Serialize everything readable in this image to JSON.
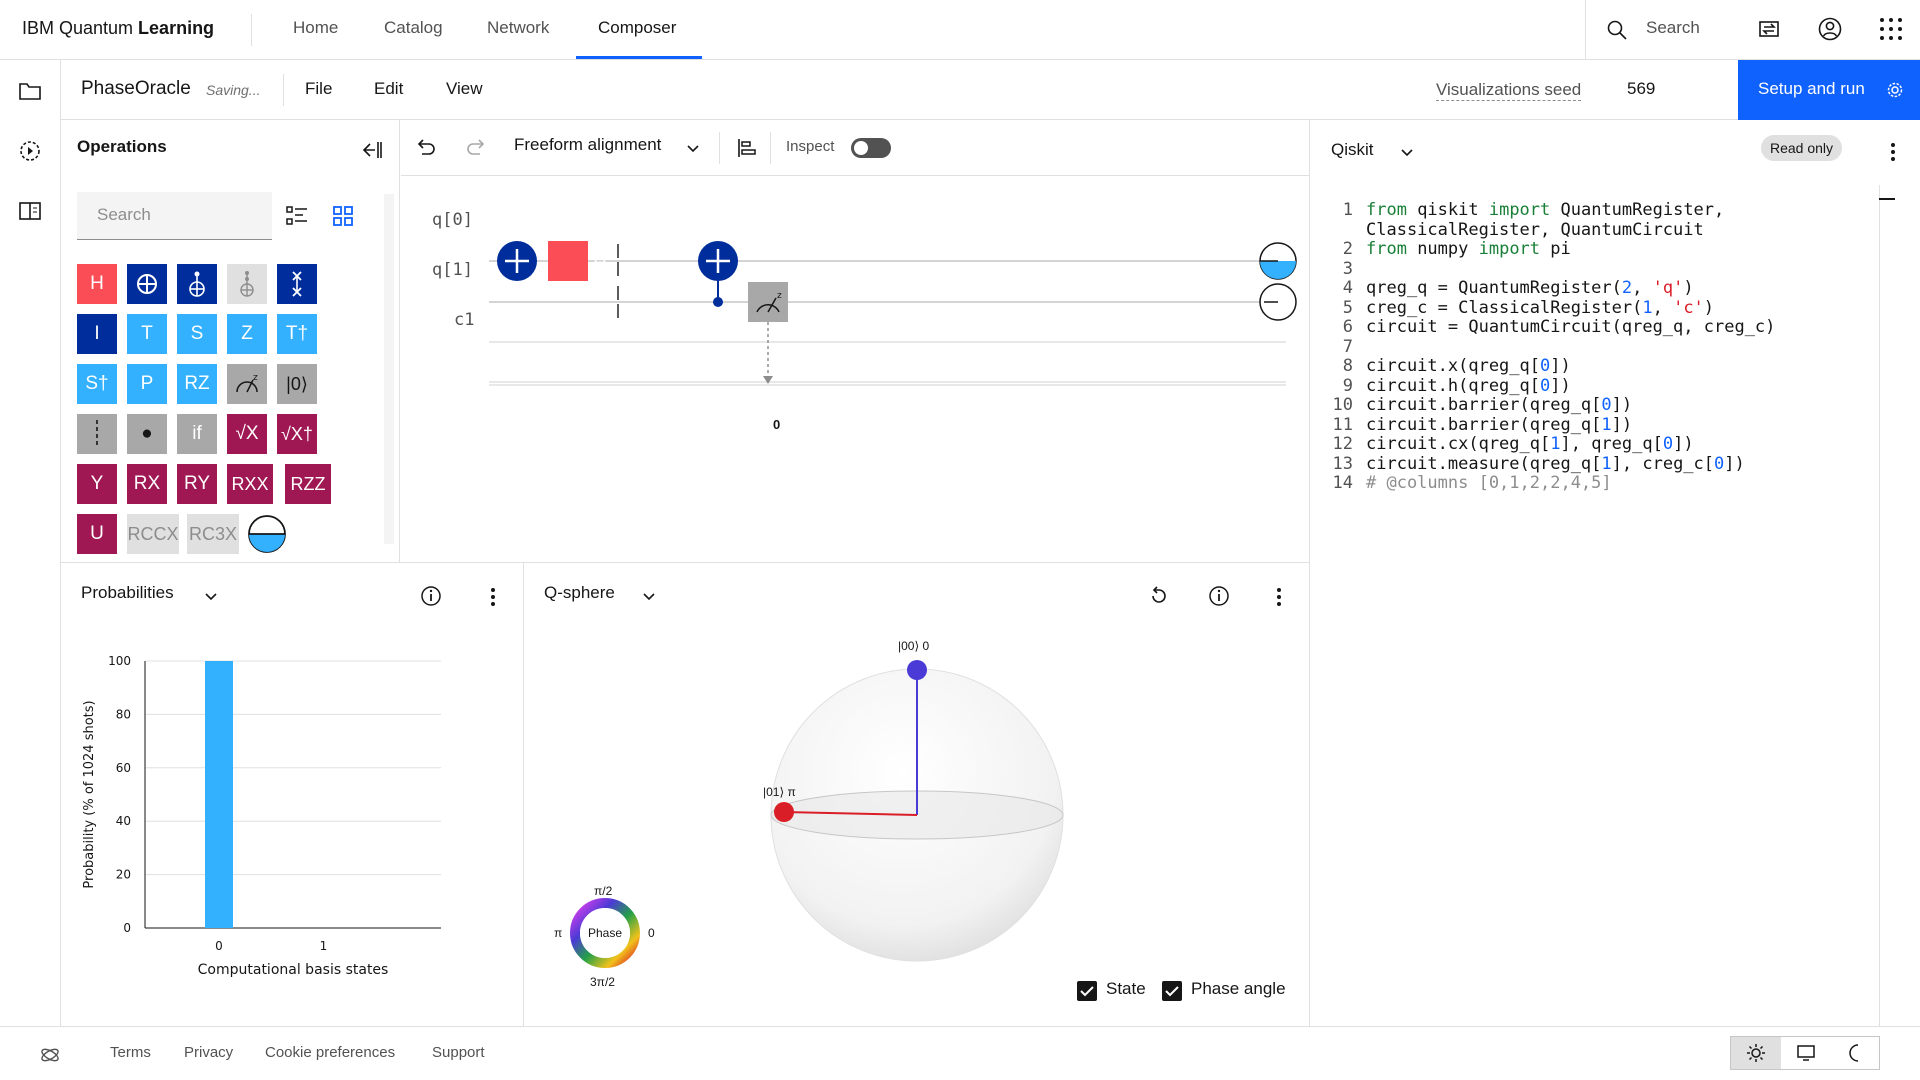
{
  "header": {
    "brand_prefix": "IBM Quantum ",
    "brand_bold": "Learning",
    "nav": [
      "Home",
      "Catalog",
      "Network",
      "Composer"
    ],
    "active_nav": "Composer",
    "search_label": "Search"
  },
  "toolbar": {
    "file_name": "PhaseOracle",
    "status": "Saving...",
    "menus": [
      "File",
      "Edit",
      "View"
    ],
    "seed_label": "Visualizations seed",
    "seed_value": "569",
    "run_label": "Setup and run"
  },
  "operations": {
    "title": "Operations",
    "search_placeholder": "Search",
    "gates": [
      {
        "label": "H",
        "color": "#fa4d56"
      },
      {
        "label": "⊕",
        "color": "#002d9c"
      },
      {
        "label": "cx",
        "color": "#002d9c"
      },
      {
        "label": "ccx",
        "color": "#e0e0e0"
      },
      {
        "label": "swap",
        "color": "#002d9c"
      },
      {
        "label": "I",
        "color": "#002d9c"
      },
      {
        "label": "T",
        "color": "#33b1ff"
      },
      {
        "label": "S",
        "color": "#33b1ff"
      },
      {
        "label": "Z",
        "color": "#33b1ff"
      },
      {
        "label": "T†",
        "color": "#33b1ff"
      },
      {
        "label": "S†",
        "color": "#33b1ff"
      },
      {
        "label": "P",
        "color": "#33b1ff"
      },
      {
        "label": "RZ",
        "color": "#33b1ff"
      },
      {
        "label": "measure-z",
        "color": "#a8a8a8"
      },
      {
        "label": "|0⟩",
        "color": "#a8a8a8"
      },
      {
        "label": "barrier",
        "color": "#a8a8a8"
      },
      {
        "label": "●",
        "color": "#a8a8a8"
      },
      {
        "label": "if",
        "color": "#a8a8a8"
      },
      {
        "label": "√X",
        "color": "#9f1853"
      },
      {
        "label": "√X†",
        "color": "#9f1853"
      },
      {
        "label": "Y",
        "color": "#9f1853"
      },
      {
        "label": "RX",
        "color": "#9f1853"
      },
      {
        "label": "RY",
        "color": "#9f1853"
      },
      {
        "label": "RXX",
        "color": "#9f1853"
      },
      {
        "label": "RZZ",
        "color": "#9f1853"
      },
      {
        "label": "U",
        "color": "#9f1853"
      },
      {
        "label": "RCCX",
        "color": "#e0e0e0"
      },
      {
        "label": "RC3X",
        "color": "#e0e0e0"
      },
      {
        "label": "state",
        "color": "#ffffff"
      }
    ]
  },
  "composer": {
    "alignment": "Freeform alignment",
    "inspect_label": "Inspect",
    "qubits": [
      "q[0]",
      "q[1]"
    ],
    "classical": "c1",
    "h_label": "H",
    "measure_bit": "0"
  },
  "qiskit": {
    "title": "Qiskit",
    "badge": "Read only",
    "lines": [
      {
        "n": "1",
        "t": "from qiskit import QuantumRegister,"
      },
      {
        "n": "",
        "t": "ClassicalRegister, QuantumCircuit"
      },
      {
        "n": "2",
        "t": "from numpy import pi"
      },
      {
        "n": "3",
        "t": ""
      },
      {
        "n": "4",
        "t": "qreg_q = QuantumRegister(2, 'q')"
      },
      {
        "n": "5",
        "t": "creg_c = ClassicalRegister(1, 'c')"
      },
      {
        "n": "6",
        "t": "circuit = QuantumCircuit(qreg_q, creg_c)"
      },
      {
        "n": "7",
        "t": ""
      },
      {
        "n": "8",
        "t": "circuit.x(qreg_q[0])"
      },
      {
        "n": "9",
        "t": "circuit.h(qreg_q[0])"
      },
      {
        "n": "10",
        "t": "circuit.barrier(qreg_q[0])"
      },
      {
        "n": "11",
        "t": "circuit.barrier(qreg_q[1])"
      },
      {
        "n": "12",
        "t": "circuit.cx(qreg_q[1], qreg_q[0])"
      },
      {
        "n": "13",
        "t": "circuit.measure(qreg_q[1], creg_c[0])"
      },
      {
        "n": "14",
        "t": "# @columns [0,1,2,2,4,5]"
      }
    ]
  },
  "probabilities": {
    "title": "Probabilities",
    "chart_data": {
      "type": "bar",
      "categories": [
        "0",
        "1"
      ],
      "values": [
        100,
        0
      ],
      "ylabel": "Probability (% of 1024 shots)",
      "xlabel": "Computational basis states",
      "ylim": [
        0,
        100
      ],
      "yticks": [
        "0",
        "20",
        "40",
        "60",
        "80",
        "100"
      ]
    }
  },
  "qsphere": {
    "title": "Q-sphere",
    "state_00": "|00⟩ 0",
    "state_01": "|01⟩ π",
    "phase_label": "Phase",
    "phase_top": "π/2",
    "phase_left": "π",
    "phase_right": "0",
    "phase_bottom": "3π/2",
    "chk_state": "State",
    "chk_phase": "Phase angle",
    "colors": {
      "state00": "#4b3bd6",
      "state01": "#da1e28"
    }
  },
  "footer": {
    "links": [
      "Terms",
      "Privacy",
      "Cookie preferences",
      "Support"
    ]
  },
  "colors": {
    "accent": "#0f62fe"
  }
}
